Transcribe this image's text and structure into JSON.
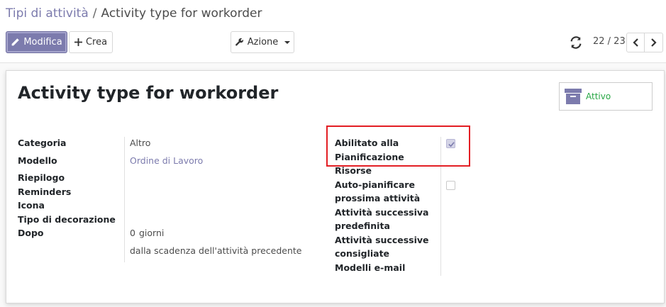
{
  "breadcrumb": {
    "parent": "Tipi di attività",
    "separator": "/",
    "current": "Activity type for workorder"
  },
  "toolbar": {
    "edit_label": "Modifica",
    "create_label": "Crea",
    "action_label": "Azione",
    "pager": "22 / 23"
  },
  "record": {
    "title": "Activity type for workorder",
    "active_label": "Attivo"
  },
  "left_fields": {
    "categoria": {
      "label": "Categoria",
      "value": "Altro"
    },
    "modello": {
      "label": "Modello",
      "value": "Ordine di Lavoro"
    },
    "riepilogo": {
      "label": "Riepilogo"
    },
    "reminders": {
      "label": "Reminders"
    },
    "icona": {
      "label": "Icona"
    },
    "tipo_decorazione": {
      "label": "Tipo di decorazione"
    },
    "dopo": {
      "label": "Dopo",
      "value": "0",
      "unit": "giorni",
      "note": "dalla scadenza dell'attività precedente"
    }
  },
  "right_fields": {
    "abilitato_line1": "Abilitato alla",
    "abilitato_line2": "Pianificazione",
    "abilitato_checked": true,
    "risorse": "Risorse",
    "auto_line1": "Auto-pianificare",
    "auto_line2": "prossima attività",
    "auto_checked": false,
    "successiva_line1": "Attività successiva",
    "successiva_line2": "predefinita",
    "consigliate_line1": "Attività successive",
    "consigliate_line2": "consigliate",
    "modelli_email": "Modelli e-mail"
  },
  "colors": {
    "primary": "#7c7bad",
    "active_green": "#28a745",
    "highlight_red": "#e31e24"
  }
}
